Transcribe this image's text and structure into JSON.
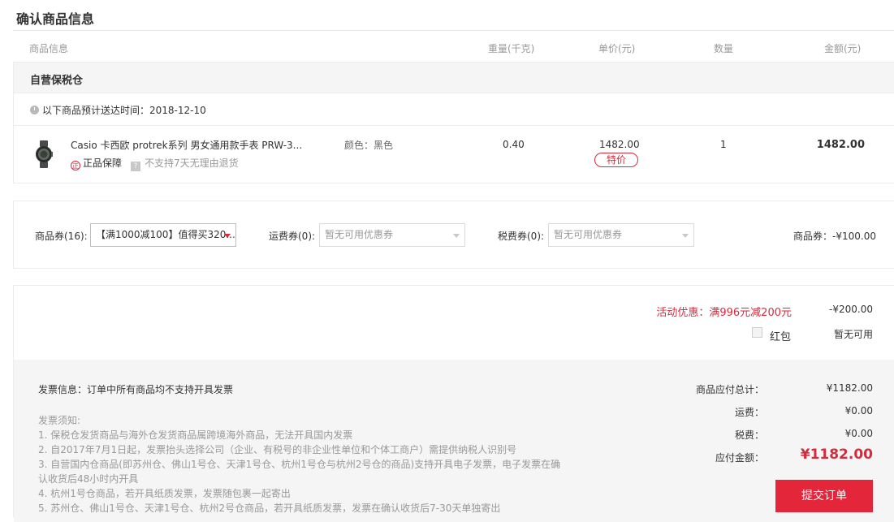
{
  "page_title": "确认商品信息",
  "columns": {
    "info": "商品信息",
    "weight": "重量(千克)",
    "price": "单价(元)",
    "qty": "数量",
    "amount": "金额(元)"
  },
  "warehouse": {
    "name": "自营保税仓",
    "delivery": "以下商品预计送达时间：2018-12-10"
  },
  "item": {
    "name": "Casio 卡西欧 protrek系列 男女通用款手表 PRW-3...",
    "color": "颜色：黑色",
    "weight": "0.40",
    "price": "1482.00",
    "tag": "特价",
    "qty": "1",
    "amount": "1482.00",
    "guarantee": "正品保障",
    "guarantee_icon_text": "正",
    "noreturn": "不支持7天无理由退货",
    "noreturn_icon_text": "?"
  },
  "coupons": {
    "product_label": "商品券(16):",
    "product_value": "【满1000减100】值得买320...",
    "shipping_label": "运费券(0):",
    "shipping_value": "暂无可用优惠券",
    "tax_label": "税费券(0):",
    "tax_value": "暂无可用优惠券",
    "total": "商品券：-¥100.00"
  },
  "promotions": {
    "activity_label": "活动优惠：满996元减200元",
    "activity_value": "-¥200.00",
    "hongbao_label": "红包",
    "hongbao_value": "暂无可用"
  },
  "invoice": {
    "info": "发票信息：订单中所有商品均不支持开具发票",
    "notes_title": "发票须知:",
    "notes": [
      "1. 保税仓发货商品与海外仓发货商品属跨境海外商品，无法开具国内发票",
      "2. 自2017年7月1日起，发票抬头选择公司（企业、有税号的非企业性单位和个体工商户）需提供纳税人识别号",
      "3. 自营国内仓商品(即苏州仓、佛山1号仓、天津1号仓、杭州1号仓与杭州2号仓的商品)支持开具电子发票，电子发票在确",
      "认收货后48小时内开具",
      "4. 杭州1号仓商品，若开具纸质发票，发票随包裹一起寄出",
      "5. 苏州仓、佛山1号仓、天津1号仓、杭州2号仓商品，若开具纸质发票，发票在确认收货后7-30天单独寄出"
    ]
  },
  "summary": {
    "subtotal_label": "商品应付总计：",
    "subtotal_value": "¥1182.00",
    "shipping_label": "运费：",
    "shipping_value": "¥0.00",
    "tax_label": "税费：",
    "tax_value": "¥0.00",
    "total_label": "应付金额：",
    "total_value": "¥1182.00",
    "submit_label": "提交订单"
  },
  "colors": {
    "accent": "#e4263a",
    "promo_text": "#d62b3d",
    "panel_bg": "#f5f5f5"
  }
}
